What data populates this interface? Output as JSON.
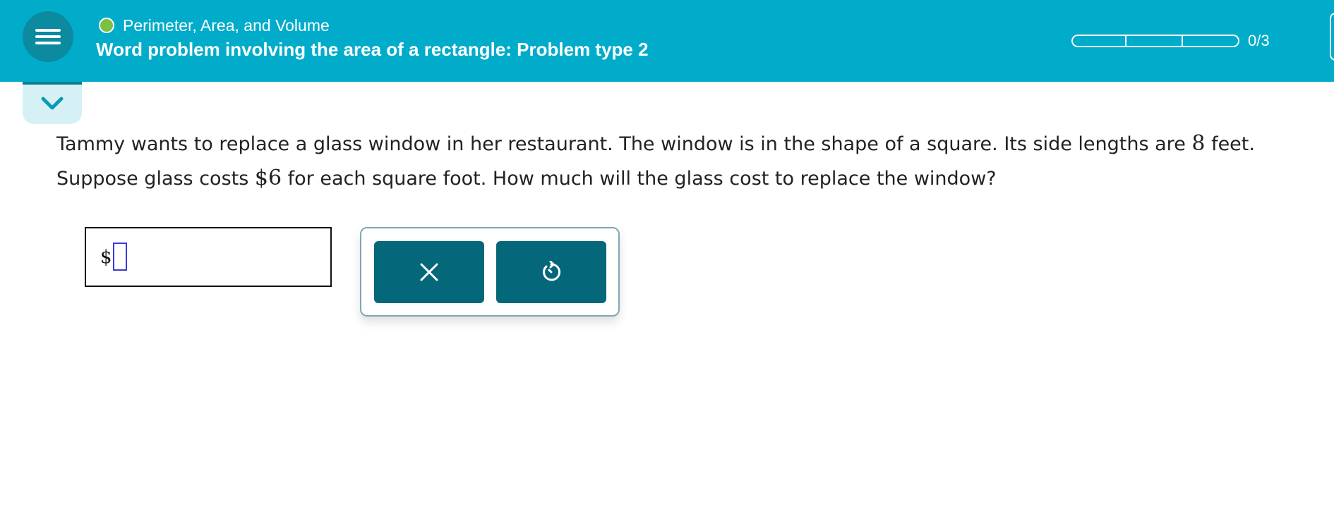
{
  "header": {
    "topic": "Perimeter, Area, and Volume",
    "problem_title": "Word problem involving the area of a rectangle: Problem type 2",
    "progress": {
      "completed": 0,
      "total": 3,
      "label": "0/3"
    },
    "status_color": "#7bc043",
    "bar_color": "#00acc9"
  },
  "icons": {
    "menu": "hamburger-menu-icon",
    "collapse": "chevron-down-icon",
    "clear": "close-icon",
    "undo": "undo-icon"
  },
  "question": {
    "line1_a": "Tammy wants to replace a glass window in her restaurant. The window is in the shape of a square. Its side lengths are ",
    "side_length": "8",
    "line1_b": " feet.",
    "line2_a": "Suppose glass costs ",
    "price": "$6",
    "line2_b": " for each square foot. How much will the glass cost to replace the window?"
  },
  "answer": {
    "prefix": "$",
    "value": ""
  }
}
